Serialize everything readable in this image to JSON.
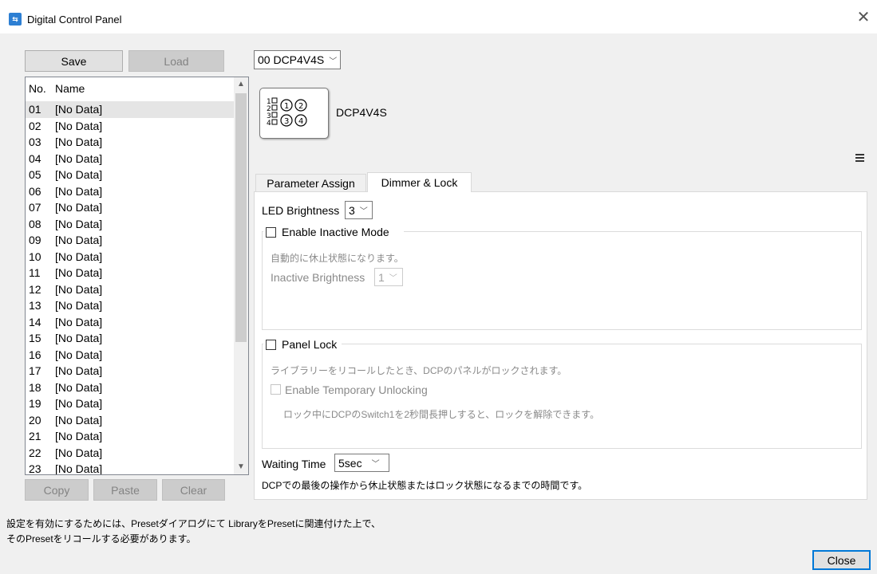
{
  "window": {
    "title": "Digital Control Panel",
    "close_glyph": "✕",
    "close_button": "Close"
  },
  "library": {
    "save": "Save",
    "load": "Load",
    "header_no": "No.",
    "header_name": "Name",
    "items": [
      {
        "no": "01",
        "name": "[No Data]"
      },
      {
        "no": "02",
        "name": "[No Data]"
      },
      {
        "no": "03",
        "name": "[No Data]"
      },
      {
        "no": "04",
        "name": "[No Data]"
      },
      {
        "no": "05",
        "name": "[No Data]"
      },
      {
        "no": "06",
        "name": "[No Data]"
      },
      {
        "no": "07",
        "name": "[No Data]"
      },
      {
        "no": "08",
        "name": "[No Data]"
      },
      {
        "no": "09",
        "name": "[No Data]"
      },
      {
        "no": "10",
        "name": "[No Data]"
      },
      {
        "no": "11",
        "name": "[No Data]"
      },
      {
        "no": "12",
        "name": "[No Data]"
      },
      {
        "no": "13",
        "name": "[No Data]"
      },
      {
        "no": "14",
        "name": "[No Data]"
      },
      {
        "no": "15",
        "name": "[No Data]"
      },
      {
        "no": "16",
        "name": "[No Data]"
      },
      {
        "no": "17",
        "name": "[No Data]"
      },
      {
        "no": "18",
        "name": "[No Data]"
      },
      {
        "no": "19",
        "name": "[No Data]"
      },
      {
        "no": "20",
        "name": "[No Data]"
      },
      {
        "no": "21",
        "name": "[No Data]"
      },
      {
        "no": "22",
        "name": "[No Data]"
      },
      {
        "no": "23",
        "name": "[No Data]"
      }
    ],
    "selected_index": 0,
    "copy": "Copy",
    "paste": "Paste",
    "clear": "Clear"
  },
  "device": {
    "selector": "00 DCP4V4S",
    "model": "DCP4V4S",
    "image_rows": [
      "1▢ ①②",
      "2▢",
      "3▢ ③④",
      "4▢"
    ]
  },
  "tabs": [
    {
      "label": "Parameter Assign",
      "active": false
    },
    {
      "label": "Dimmer & Lock",
      "active": true
    }
  ],
  "dimmer": {
    "led_brightness_label": "LED Brightness",
    "led_brightness_value": "3",
    "inactive_mode_label": "Enable Inactive Mode",
    "inactive_mode_desc": "自動的に休止状態になります。",
    "inactive_brightness_label": "Inactive Brightness",
    "inactive_brightness_value": "1",
    "panel_lock_label": "Panel Lock",
    "panel_lock_desc": "ライブラリーをリコールしたとき、DCPのパネルがロックされます。",
    "temp_unlock_label": "Enable Temporary Unlocking",
    "temp_unlock_desc": "ロック中にDCPのSwitch1を2秒間長押しすると、ロックを解除できます。",
    "waiting_time_label": "Waiting Time",
    "waiting_time_value": "5sec",
    "waiting_time_desc": "DCPでの最後の操作から休止状態またはロック状態になるまでの時間です。"
  },
  "footer": {
    "note_line1": "設定を有効にするためには、Presetダイアログにて LibraryをPresetに関連付けた上で、",
    "note_line2": "そのPresetをリコールする必要があります。"
  }
}
